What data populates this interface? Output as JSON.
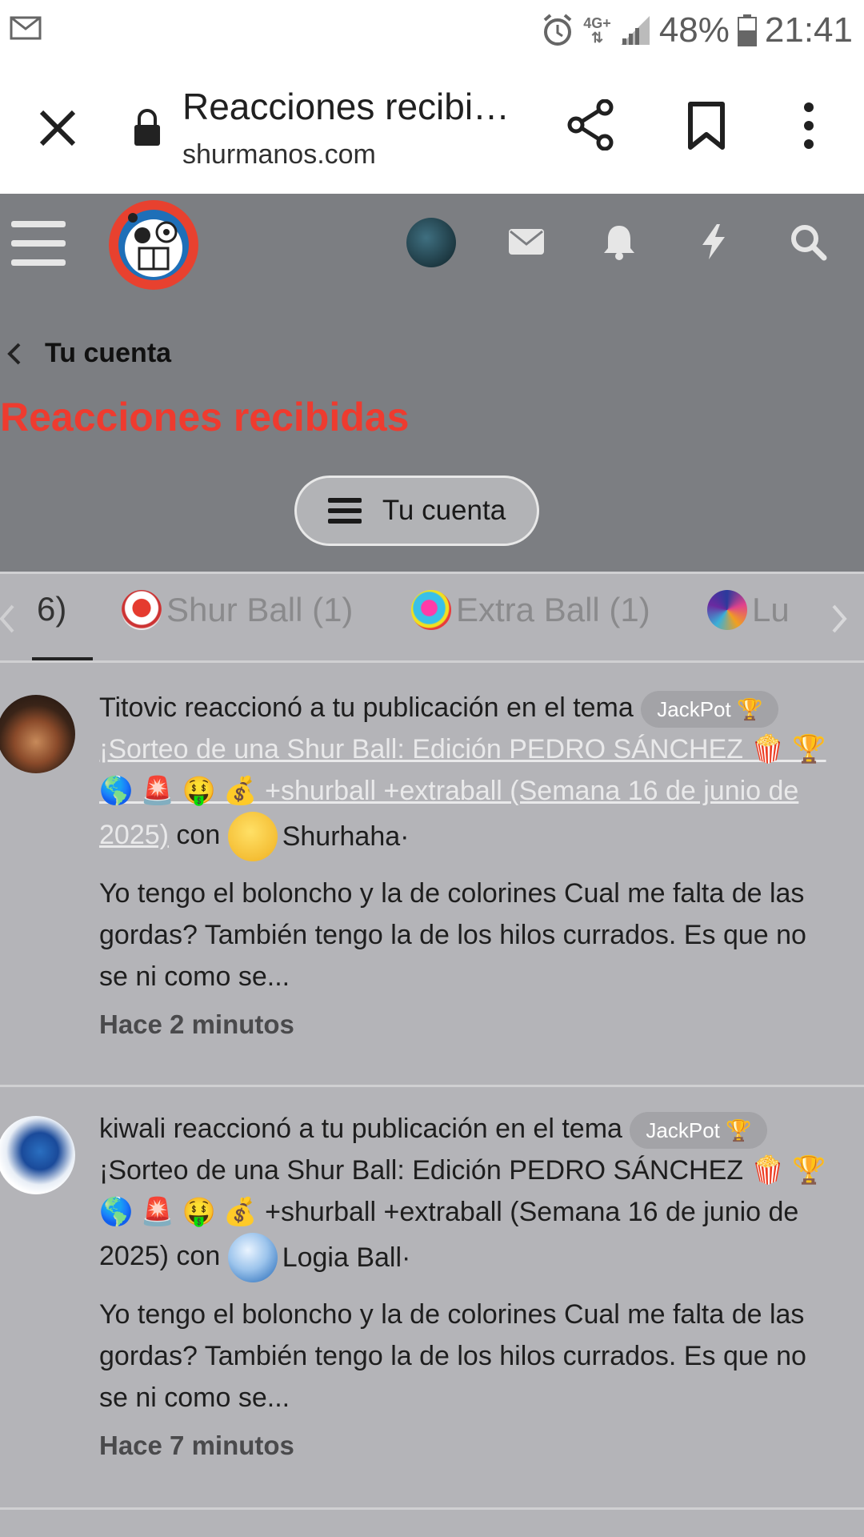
{
  "status_bar": {
    "network": "4G+",
    "battery": "48%",
    "time": "21:41"
  },
  "browser": {
    "title": "Reacciones recibi…",
    "domain": "shurmanos.com"
  },
  "site": {
    "breadcrumb": "Tu cuenta",
    "section_title": "Reacciones recibidas",
    "account_button": "Tu cuenta"
  },
  "tabs": [
    {
      "label": "6)",
      "icon": "",
      "active": true
    },
    {
      "label": "Shur Ball (1)",
      "icon": "shur-ball-icon",
      "active": false
    },
    {
      "label": "Extra Ball (1)",
      "icon": "extra-ball-icon",
      "active": false
    },
    {
      "label": "Lu",
      "icon": "swirl-ball-icon",
      "active": false
    }
  ],
  "items": [
    {
      "user": "Titovic",
      "action": "reaccionó a tu publicación en el tema",
      "badge": "JackPot 🏆",
      "thread": "¡Sorteo de una Shur Ball: Edición PEDRO SÁNCHEZ 🍿 🏆 🌎 🚨 🤑 💰 +shurball +extraball (Semana 16 de junio de 2025)",
      "con": "con",
      "reaction": "Shurhaha·",
      "snippet": "Yo tengo el boloncho y la de colorines Cual me falta de las gordas? También tengo la de los hilos currados. Es que no se ni como se...",
      "time": "Hace 2 minutos"
    },
    {
      "user": "kiwali",
      "action": "reaccionó a tu publicación en el tema",
      "badge": "JackPot 🏆",
      "thread": "¡Sorteo de una Shur Ball: Edición PEDRO SÁNCHEZ 🍿 🏆 🌎 🚨 🤑 💰 +shurball +extraball (Semana 16 de junio de 2025)",
      "con": "con",
      "reaction": "Logia Ball·",
      "snippet": "Yo tengo el boloncho y la de colorines Cual me falta de las gordas? También tengo la de los hilos currados. Es que no se ni como se...",
      "time": "Hace 7 minutos"
    }
  ],
  "colors": {
    "accent_red": "#ee3b2f",
    "header_bg": "#7c7e82",
    "content_bg": "#b4b4b8"
  }
}
